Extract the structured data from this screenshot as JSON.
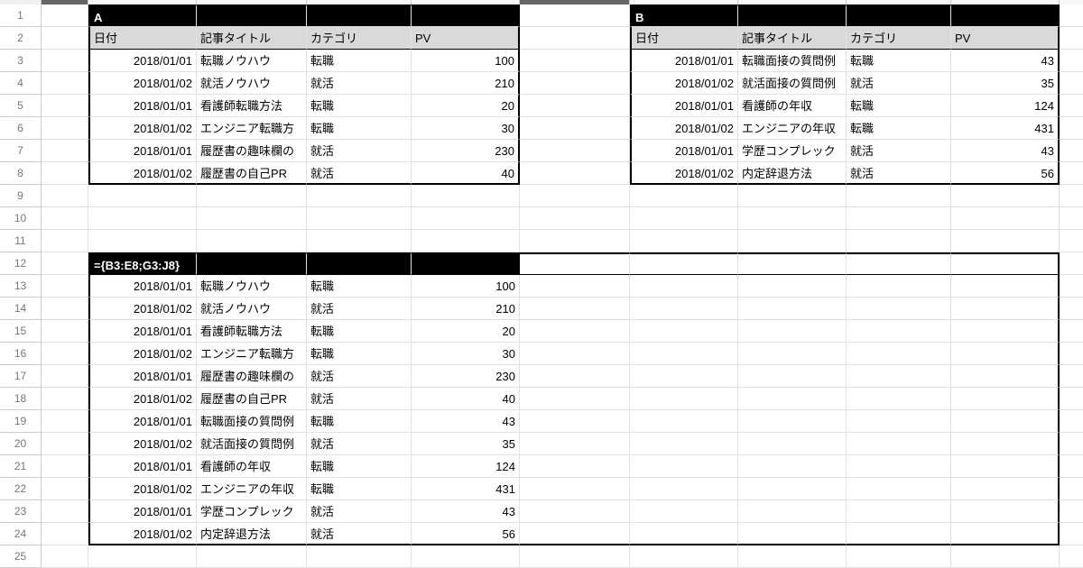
{
  "rownums": [
    "1",
    "2",
    "3",
    "4",
    "5",
    "6",
    "7",
    "8",
    "9",
    "10",
    "11",
    "12",
    "13",
    "14",
    "15",
    "16",
    "17",
    "18",
    "19",
    "20",
    "21",
    "22",
    "23",
    "24",
    "25"
  ],
  "labelA": "A",
  "labelB": "B",
  "headers": {
    "date": "日付",
    "title": "記事タイトル",
    "cat": "カテゴリ",
    "pv": "PV"
  },
  "tableA": [
    {
      "date": "2018/01/01",
      "title": "転職ノウハウ",
      "cat": "転職",
      "pv": "100"
    },
    {
      "date": "2018/01/02",
      "title": "就活ノウハウ",
      "cat": "就活",
      "pv": "210"
    },
    {
      "date": "2018/01/01",
      "title": "看護師転職方法",
      "cat": "転職",
      "pv": "20"
    },
    {
      "date": "2018/01/02",
      "title": "エンジニア転職方",
      "cat": "転職",
      "pv": "30"
    },
    {
      "date": "2018/01/01",
      "title": "履歴書の趣味欄の",
      "cat": "就活",
      "pv": "230"
    },
    {
      "date": "2018/01/02",
      "title": "履歴書の自己PR",
      "cat": "就活",
      "pv": "40"
    }
  ],
  "tableB": [
    {
      "date": "2018/01/01",
      "title": "転職面接の質問例",
      "cat": "転職",
      "pv": "43"
    },
    {
      "date": "2018/01/02",
      "title": "就活面接の質問例",
      "cat": "就活",
      "pv": "35"
    },
    {
      "date": "2018/01/01",
      "title": "看護師の年収",
      "cat": "転職",
      "pv": "124"
    },
    {
      "date": "2018/01/02",
      "title": "エンジニアの年収",
      "cat": "転職",
      "pv": "431"
    },
    {
      "date": "2018/01/01",
      "title": "学歴コンプレック",
      "cat": "就活",
      "pv": "43"
    },
    {
      "date": "2018/01/02",
      "title": "内定辞退方法",
      "cat": "就活",
      "pv": "56"
    }
  ],
  "formula": "={B3:E8;G3:J8}",
  "merged": [
    {
      "date": "2018/01/01",
      "title": "転職ノウハウ",
      "cat": "転職",
      "pv": "100"
    },
    {
      "date": "2018/01/02",
      "title": "就活ノウハウ",
      "cat": "就活",
      "pv": "210"
    },
    {
      "date": "2018/01/01",
      "title": "看護師転職方法",
      "cat": "転職",
      "pv": "20"
    },
    {
      "date": "2018/01/02",
      "title": "エンジニア転職方",
      "cat": "転職",
      "pv": "30"
    },
    {
      "date": "2018/01/01",
      "title": "履歴書の趣味欄の",
      "cat": "就活",
      "pv": "230"
    },
    {
      "date": "2018/01/02",
      "title": "履歴書の自己PR",
      "cat": "就活",
      "pv": "40"
    },
    {
      "date": "2018/01/01",
      "title": "転職面接の質問例",
      "cat": "転職",
      "pv": "43"
    },
    {
      "date": "2018/01/02",
      "title": "就活面接の質問例",
      "cat": "就活",
      "pv": "35"
    },
    {
      "date": "2018/01/01",
      "title": "看護師の年収",
      "cat": "転職",
      "pv": "124"
    },
    {
      "date": "2018/01/02",
      "title": "エンジニアの年収",
      "cat": "転職",
      "pv": "431"
    },
    {
      "date": "2018/01/01",
      "title": "学歴コンプレック",
      "cat": "就活",
      "pv": "43"
    },
    {
      "date": "2018/01/02",
      "title": "内定辞退方法",
      "cat": "就活",
      "pv": "56"
    }
  ]
}
